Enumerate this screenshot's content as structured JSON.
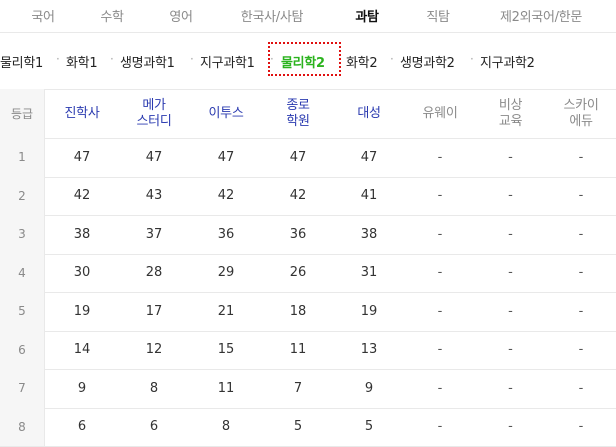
{
  "top_tabs": [
    {
      "label": "국어",
      "active": false
    },
    {
      "label": "수학",
      "active": false
    },
    {
      "label": "영어",
      "active": false
    },
    {
      "label": "한국사/사탐",
      "active": false
    },
    {
      "label": "과탐",
      "active": true
    },
    {
      "label": "직탐",
      "active": false
    },
    {
      "label": "제2외국어/한문",
      "active": false
    }
  ],
  "subjects": [
    {
      "label": "물리학1",
      "active": false
    },
    {
      "label": "화학1",
      "active": false
    },
    {
      "label": "생명과학1",
      "active": false
    },
    {
      "label": "지구과학1",
      "active": false
    },
    {
      "label": "물리학2",
      "active": true
    },
    {
      "label": "화학2",
      "active": false
    },
    {
      "label": "생명과학2",
      "active": false
    },
    {
      "label": "지구과학2",
      "active": false
    }
  ],
  "separator": "·",
  "table": {
    "grade_header": "등급",
    "providers": [
      {
        "label": "진학사",
        "lines": [
          "진학사"
        ],
        "style": "blue"
      },
      {
        "label": "메가스터디",
        "lines": [
          "메가",
          "스터디"
        ],
        "style": "blue"
      },
      {
        "label": "이투스",
        "lines": [
          "이투스"
        ],
        "style": "blue"
      },
      {
        "label": "종로학원",
        "lines": [
          "종로",
          "학원"
        ],
        "style": "blue"
      },
      {
        "label": "대성",
        "lines": [
          "대성"
        ],
        "style": "blue"
      },
      {
        "label": "유웨이",
        "lines": [
          "유웨이"
        ],
        "style": "gray"
      },
      {
        "label": "비상교육",
        "lines": [
          "비상",
          "교육"
        ],
        "style": "gray"
      },
      {
        "label": "스카이에듀",
        "lines": [
          "스카이",
          "에듀"
        ],
        "style": "gray"
      }
    ],
    "rows": [
      {
        "grade": "1",
        "values": [
          "47",
          "47",
          "47",
          "47",
          "47",
          "-",
          "-",
          "-"
        ]
      },
      {
        "grade": "2",
        "values": [
          "42",
          "43",
          "42",
          "42",
          "41",
          "-",
          "-",
          "-"
        ]
      },
      {
        "grade": "3",
        "values": [
          "38",
          "37",
          "36",
          "36",
          "38",
          "-",
          "-",
          "-"
        ]
      },
      {
        "grade": "4",
        "values": [
          "30",
          "28",
          "29",
          "26",
          "31",
          "-",
          "-",
          "-"
        ]
      },
      {
        "grade": "5",
        "values": [
          "19",
          "17",
          "21",
          "18",
          "19",
          "-",
          "-",
          "-"
        ]
      },
      {
        "grade": "6",
        "values": [
          "14",
          "12",
          "15",
          "11",
          "13",
          "-",
          "-",
          "-"
        ]
      },
      {
        "grade": "7",
        "values": [
          "9",
          "8",
          "11",
          "7",
          "9",
          "-",
          "-",
          "-"
        ]
      },
      {
        "grade": "8",
        "values": [
          "6",
          "6",
          "8",
          "5",
          "5",
          "-",
          "-",
          "-"
        ]
      }
    ]
  }
}
